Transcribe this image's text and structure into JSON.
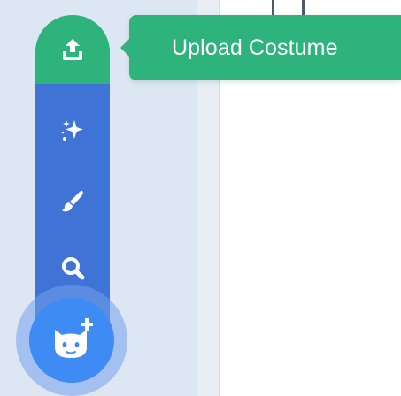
{
  "menu": {
    "tooltip_text": "Upload Costume",
    "items": [
      {
        "name": "upload",
        "icon": "upload-icon"
      },
      {
        "name": "surprise",
        "icon": "sparkle-icon"
      },
      {
        "name": "paint",
        "icon": "paintbrush-icon"
      },
      {
        "name": "search",
        "icon": "magnifier-icon"
      }
    ],
    "main_button_icon": "cat-plus-icon"
  },
  "colors": {
    "upload_green": "#2fb37c",
    "menu_blue": "#3f74d6",
    "main_button_blue": "#3f8bf4",
    "panel_background": "#dde7f3"
  }
}
